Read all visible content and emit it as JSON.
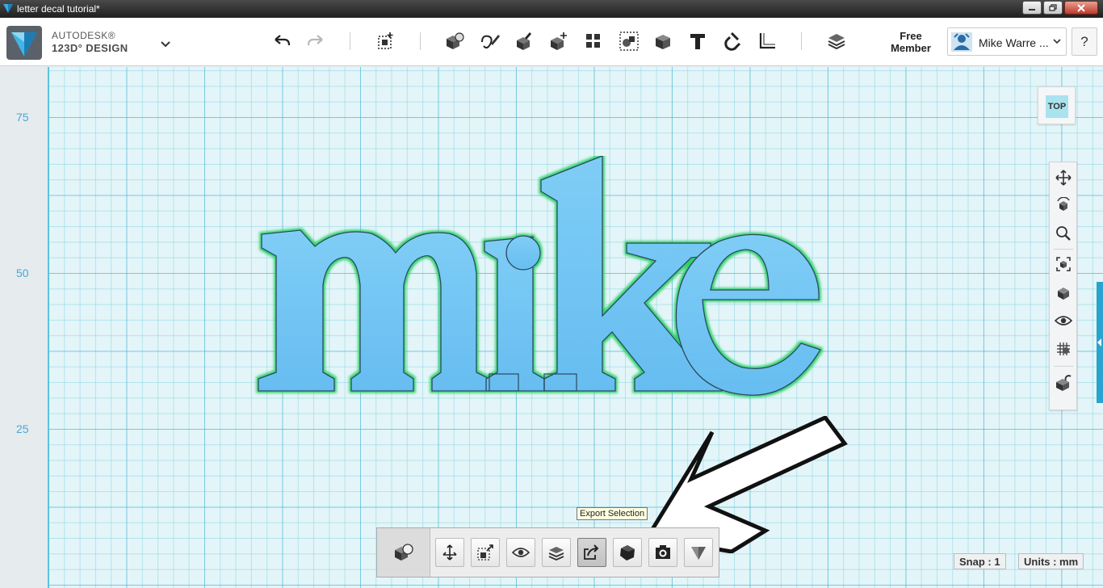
{
  "window": {
    "title": "letter decal tutorial*"
  },
  "brand": {
    "line1": "AUTODESK®",
    "line2": "123D° DESIGN"
  },
  "account": {
    "membership": "Free Member",
    "user_name": "Mike Warre ...",
    "help_label": "?"
  },
  "view": {
    "viewcube_label": "TOP"
  },
  "ruler": {
    "labels": [
      "75",
      "50",
      "25"
    ]
  },
  "context_toolbar": {
    "tooltip": "Export Selection",
    "active_tool": "export-selection"
  },
  "status": {
    "snap": "Snap : 1",
    "units": "Units : mm"
  },
  "colors": {
    "accent": "#2aa3cf",
    "model_fill": "#6cc2f2",
    "model_glow": "#2fd06a",
    "grid_bg": "#e3f5f8"
  }
}
